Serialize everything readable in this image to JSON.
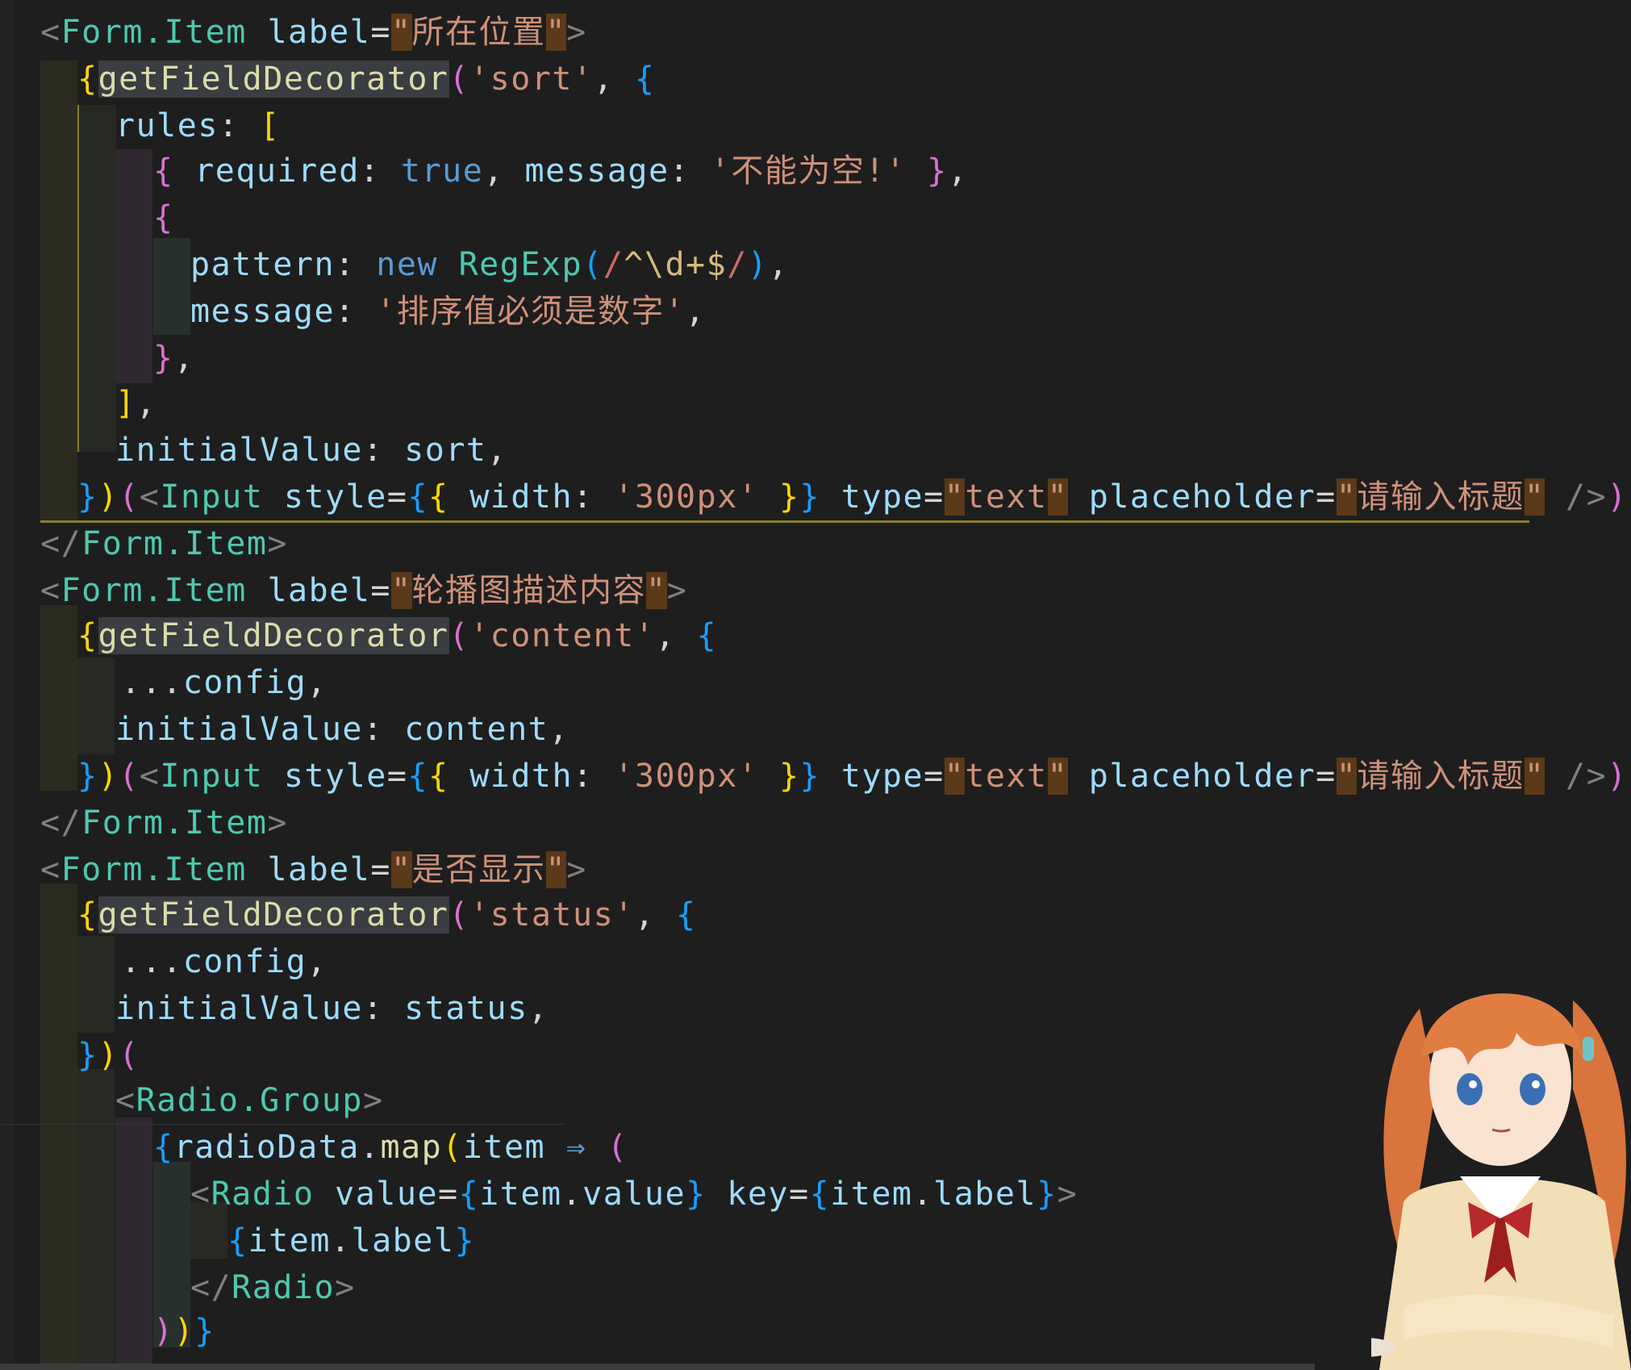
{
  "editor": {
    "lines": [
      [
        [
          "t-punc",
          "<"
        ],
        [
          "t-tag",
          "Form.Item"
        ],
        [
          "t-white",
          " "
        ],
        [
          "t-attr",
          "label"
        ],
        [
          "t-white",
          "="
        ],
        [
          "t-quote",
          "\""
        ],
        [
          "t-str",
          "所在位置"
        ],
        [
          "t-quote",
          "\""
        ],
        [
          "t-punc",
          ">"
        ]
      ],
      [
        [
          "t-brace-y",
          "{"
        ],
        [
          "t-fn-hl",
          "getFieldDecorator"
        ],
        [
          "t-brace-p",
          "("
        ],
        [
          "t-str",
          "'sort'"
        ],
        [
          "t-white",
          ", "
        ],
        [
          "t-brace-b",
          "{"
        ]
      ],
      [
        [
          "t-var",
          "rules"
        ],
        [
          "t-white",
          ": "
        ],
        [
          "t-brace-y",
          "["
        ]
      ],
      [
        [
          "t-brace-p",
          "{"
        ],
        [
          "t-white",
          " "
        ],
        [
          "t-var",
          "required"
        ],
        [
          "t-white",
          ": "
        ],
        [
          "t-kw",
          "true"
        ],
        [
          "t-white",
          ", "
        ],
        [
          "t-var",
          "message"
        ],
        [
          "t-white",
          ": "
        ],
        [
          "t-str",
          "'不能为空!'"
        ],
        [
          "t-white",
          " "
        ],
        [
          "t-brace-p",
          "}"
        ],
        [
          "t-white",
          ","
        ]
      ],
      [
        [
          "t-brace-p",
          "{"
        ]
      ],
      [
        [
          "t-var",
          "pattern"
        ],
        [
          "t-white",
          ": "
        ],
        [
          "t-kw",
          "new"
        ],
        [
          "t-white",
          " "
        ],
        [
          "t-cls",
          "RegExp"
        ],
        [
          "t-brace-b",
          "("
        ],
        [
          "t-rx",
          "/"
        ],
        [
          "t-rx2",
          "^\\d+$"
        ],
        [
          "t-rx",
          "/"
        ],
        [
          "t-brace-b",
          ")"
        ],
        [
          "t-white",
          ","
        ]
      ],
      [
        [
          "t-var",
          "message"
        ],
        [
          "t-white",
          ": "
        ],
        [
          "t-str",
          "'排序值必须是数字'"
        ],
        [
          "t-white",
          ","
        ]
      ],
      [
        [
          "t-brace-p",
          "}"
        ],
        [
          "t-white",
          ","
        ]
      ],
      [
        [
          "t-brace-y",
          "]"
        ],
        [
          "t-white",
          ","
        ]
      ],
      [
        [
          "t-var",
          "initialValue"
        ],
        [
          "t-white",
          ": "
        ],
        [
          "t-var",
          "sort"
        ],
        [
          "t-white",
          ","
        ]
      ],
      [
        [
          "t-brace-b",
          "}"
        ],
        [
          "t-brace-y",
          ")"
        ],
        [
          "t-brace-p",
          "("
        ],
        [
          "t-punc",
          "<"
        ],
        [
          "t-cls",
          "Input"
        ],
        [
          "t-white",
          " "
        ],
        [
          "t-attr",
          "style"
        ],
        [
          "t-white",
          "="
        ],
        [
          "t-brace-b",
          "{"
        ],
        [
          "t-brace-y",
          "{"
        ],
        [
          "t-white",
          " "
        ],
        [
          "t-var",
          "width"
        ],
        [
          "t-white",
          ": "
        ],
        [
          "t-str",
          "'300px'"
        ],
        [
          "t-white",
          " "
        ],
        [
          "t-brace-y",
          "}"
        ],
        [
          "t-brace-b",
          "}"
        ],
        [
          "t-white",
          " "
        ],
        [
          "t-attr",
          "type"
        ],
        [
          "t-white",
          "="
        ],
        [
          "t-quote",
          "\""
        ],
        [
          "t-str",
          "text"
        ],
        [
          "t-quote",
          "\""
        ],
        [
          "t-white",
          " "
        ],
        [
          "t-attr",
          "placeholder"
        ],
        [
          "t-white",
          "="
        ],
        [
          "t-quote",
          "\""
        ],
        [
          "t-str",
          "请输入标题"
        ],
        [
          "t-quote",
          "\""
        ],
        [
          "t-white",
          " "
        ],
        [
          "t-punc",
          "/>"
        ],
        [
          "t-brace-p",
          ")"
        ],
        [
          "t-brace-y",
          "}"
        ]
      ],
      [
        [
          "t-punc",
          "</"
        ],
        [
          "t-tag",
          "Form.Item"
        ],
        [
          "t-punc",
          ">"
        ]
      ],
      [
        [
          "t-punc",
          "<"
        ],
        [
          "t-tag",
          "Form.Item"
        ],
        [
          "t-white",
          " "
        ],
        [
          "t-attr",
          "label"
        ],
        [
          "t-white",
          "="
        ],
        [
          "t-quote",
          "\""
        ],
        [
          "t-str",
          "轮播图描述内容"
        ],
        [
          "t-quote",
          "\""
        ],
        [
          "t-punc",
          ">"
        ]
      ],
      [
        [
          "t-brace-y",
          "{"
        ],
        [
          "t-fn-hl",
          "getFieldDecorator"
        ],
        [
          "t-brace-p",
          "("
        ],
        [
          "t-str",
          "'content'"
        ],
        [
          "t-white",
          ", "
        ],
        [
          "t-brace-b",
          "{"
        ]
      ],
      [
        [
          "t-white",
          "..."
        ],
        [
          "t-var",
          "config"
        ],
        [
          "t-white",
          ","
        ]
      ],
      [
        [
          "t-var",
          "initialValue"
        ],
        [
          "t-white",
          ": "
        ],
        [
          "t-var",
          "content"
        ],
        [
          "t-white",
          ","
        ]
      ],
      [
        [
          "t-brace-b",
          "}"
        ],
        [
          "t-brace-y",
          ")"
        ],
        [
          "t-brace-p",
          "("
        ],
        [
          "t-punc",
          "<"
        ],
        [
          "t-cls",
          "Input"
        ],
        [
          "t-white",
          " "
        ],
        [
          "t-attr",
          "style"
        ],
        [
          "t-white",
          "="
        ],
        [
          "t-brace-b",
          "{"
        ],
        [
          "t-brace-y",
          "{"
        ],
        [
          "t-white",
          " "
        ],
        [
          "t-var",
          "width"
        ],
        [
          "t-white",
          ": "
        ],
        [
          "t-str",
          "'300px'"
        ],
        [
          "t-white",
          " "
        ],
        [
          "t-brace-y",
          "}"
        ],
        [
          "t-brace-b",
          "}"
        ],
        [
          "t-white",
          " "
        ],
        [
          "t-attr",
          "type"
        ],
        [
          "t-white",
          "="
        ],
        [
          "t-quote",
          "\""
        ],
        [
          "t-str",
          "text"
        ],
        [
          "t-quote",
          "\""
        ],
        [
          "t-white",
          " "
        ],
        [
          "t-attr",
          "placeholder"
        ],
        [
          "t-white",
          "="
        ],
        [
          "t-quote",
          "\""
        ],
        [
          "t-str",
          "请输入标题"
        ],
        [
          "t-quote",
          "\""
        ],
        [
          "t-white",
          " "
        ],
        [
          "t-punc",
          "/>"
        ],
        [
          "t-brace-p",
          ")"
        ],
        [
          "t-brace-y",
          "}"
        ]
      ],
      [
        [
          "t-punc",
          "</"
        ],
        [
          "t-tag",
          "Form.Item"
        ],
        [
          "t-punc",
          ">"
        ]
      ],
      [
        [
          "t-punc",
          "<"
        ],
        [
          "t-tag",
          "Form.Item"
        ],
        [
          "t-white",
          " "
        ],
        [
          "t-attr",
          "label"
        ],
        [
          "t-white",
          "="
        ],
        [
          "t-quote",
          "\""
        ],
        [
          "t-str",
          "是否显示"
        ],
        [
          "t-quote",
          "\""
        ],
        [
          "t-punc",
          ">"
        ]
      ],
      [
        [
          "t-brace-y",
          "{"
        ],
        [
          "t-fn-hl",
          "getFieldDecorator"
        ],
        [
          "t-brace-p",
          "("
        ],
        [
          "t-str",
          "'status'"
        ],
        [
          "t-white",
          ", "
        ],
        [
          "t-brace-b",
          "{"
        ]
      ],
      [
        [
          "t-white",
          "..."
        ],
        [
          "t-var",
          "config"
        ],
        [
          "t-white",
          ","
        ]
      ],
      [
        [
          "t-var",
          "initialValue"
        ],
        [
          "t-white",
          ": "
        ],
        [
          "t-var",
          "status"
        ],
        [
          "t-white",
          ","
        ]
      ],
      [
        [
          "t-brace-b",
          "}"
        ],
        [
          "t-brace-y",
          ")"
        ],
        [
          "t-brace-p",
          "("
        ]
      ],
      [
        [
          "t-punc",
          "<"
        ],
        [
          "t-tag",
          "Radio.Group"
        ],
        [
          "t-punc",
          ">"
        ]
      ],
      [
        [
          "t-brace-b",
          "{"
        ],
        [
          "t-var",
          "radioData"
        ],
        [
          "t-white",
          "."
        ],
        [
          "t-fn",
          "map"
        ],
        [
          "t-brace-y",
          "("
        ],
        [
          "t-var",
          "item"
        ],
        [
          "t-white",
          " "
        ],
        [
          "t-arrow",
          "⇒"
        ],
        [
          "t-white",
          " "
        ],
        [
          "t-brace-p",
          "("
        ]
      ],
      [
        [
          "t-punc",
          "<"
        ],
        [
          "t-tag",
          "Radio"
        ],
        [
          "t-white",
          " "
        ],
        [
          "t-attr",
          "value"
        ],
        [
          "t-white",
          "="
        ],
        [
          "t-brace-b",
          "{"
        ],
        [
          "t-var",
          "item"
        ],
        [
          "t-white",
          "."
        ],
        [
          "t-var",
          "value"
        ],
        [
          "t-brace-b",
          "}"
        ],
        [
          "t-white",
          " "
        ],
        [
          "t-attr",
          "key"
        ],
        [
          "t-white",
          "="
        ],
        [
          "t-brace-b",
          "{"
        ],
        [
          "t-var",
          "item"
        ],
        [
          "t-white",
          "."
        ],
        [
          "t-var",
          "label"
        ],
        [
          "t-brace-b",
          "}"
        ],
        [
          "t-punc",
          ">"
        ]
      ],
      [
        [
          "t-brace-b",
          "{"
        ],
        [
          "t-var",
          "item"
        ],
        [
          "t-white",
          "."
        ],
        [
          "t-var",
          "label"
        ],
        [
          "t-brace-b",
          "}"
        ]
      ],
      [
        [
          "t-punc",
          "</"
        ],
        [
          "t-tag",
          "Radio"
        ],
        [
          "t-punc",
          ">"
        ]
      ],
      [
        [
          "t-brace-p",
          ")"
        ],
        [
          "t-brace-y",
          ")"
        ],
        [
          "t-brace-b",
          "}"
        ]
      ]
    ]
  },
  "mascot": {
    "icon": "anime-girl-mascot-icon"
  }
}
